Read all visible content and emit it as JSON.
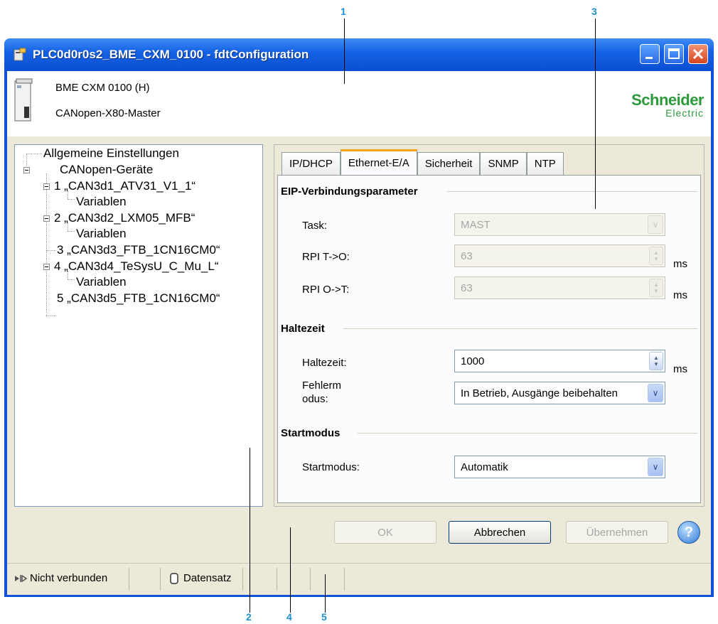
{
  "callouts": [
    "1",
    "2",
    "3",
    "4",
    "5"
  ],
  "window": {
    "title": "PLC0d0r0s2_BME_CXM_0100 - fdtConfiguration"
  },
  "header": {
    "device_name": "BME CXM 0100 (H)",
    "device_type": "CANopen-X80-Master",
    "logo_top": "Schneider",
    "logo_bottom": "Electric"
  },
  "tree": {
    "items": [
      "Allgemeine Einstellungen",
      "CANopen-Geräte",
      "1 „CAN3d1_ATV31_V1_1“",
      "Variablen",
      "2 „CAN3d2_LXM05_MFB“",
      "Variablen",
      "3 „CAN3d3_FTB_1CN16CM0“",
      "4 „CAN3d4_TeSysU_C_Mu_L“",
      "Variablen",
      "5 „CAN3d5_FTB_1CN16CM0“"
    ]
  },
  "tabs": [
    "IP/DHCP",
    "Ethernet-E/A",
    "Sicherheit",
    "SNMP",
    "NTP"
  ],
  "active_tab": "Ethernet-E/A",
  "eip": {
    "title": "EIP-Verbindungsparameter",
    "task_label": "Task:",
    "task_value": "MAST",
    "rpi_to_label": "RPI T->O:",
    "rpi_to_value": "63",
    "rpi_to_unit": "ms",
    "rpi_ot_label": "RPI O->T:",
    "rpi_ot_value": "63",
    "rpi_ot_unit": "ms"
  },
  "hold": {
    "title": "Haltezeit",
    "hold_label": "Haltezeit:",
    "hold_value": "1000",
    "hold_unit": "ms",
    "fault_label_1": "Fehlerm",
    "fault_label_2": "odus:",
    "fault_value": "In Betrieb, Ausgänge beibehalten"
  },
  "start": {
    "title": "Startmodus",
    "start_label": "Startmodus:",
    "start_value": "Automatik"
  },
  "buttons": {
    "ok": "OK",
    "cancel": "Abbrechen",
    "apply": "Übernehmen",
    "help": "?"
  },
  "status": {
    "connection": "Nicht verbunden",
    "dataset": "Datensatz"
  },
  "colors": {
    "titlebar": "#0a53d6",
    "accent_tab": "#f7a21a",
    "callout": "#1e8fd0",
    "logo": "#2c9a3c"
  }
}
